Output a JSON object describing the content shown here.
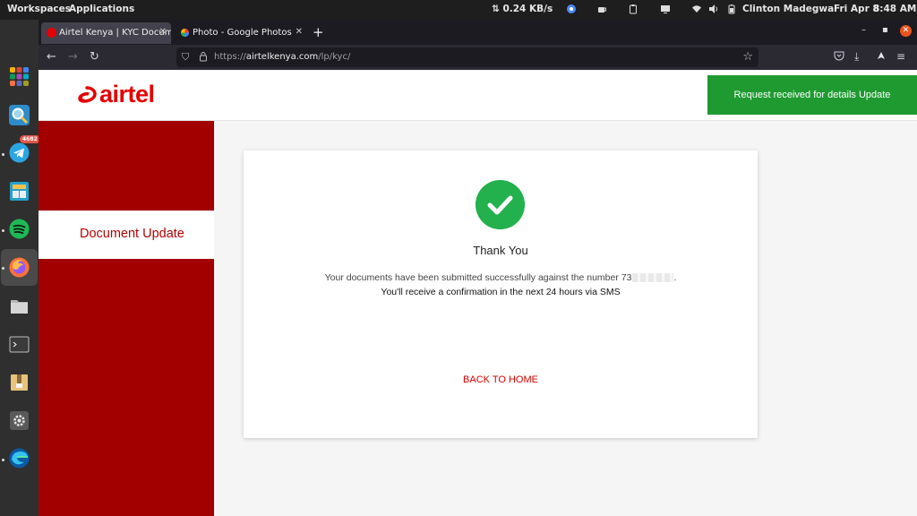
{
  "system_bar": {
    "workspaces": "Workspaces",
    "applications": "Applications",
    "net_speed": "⇅ 0.24 KB/s",
    "user": "Clinton Madegwa",
    "date": "Fri Apr 8",
    "time": "8:48 AM"
  },
  "dock": {
    "telegram_badge": "4682",
    "apps": [
      "apps-grid",
      "magnifier",
      "telegram",
      "window-manager",
      "spotify",
      "firefox",
      "files",
      "terminal",
      "archive",
      "settings",
      "edge"
    ]
  },
  "browser": {
    "tabs": [
      {
        "title": "Airtel Kenya | KYC Documen",
        "active": true
      },
      {
        "title": "Photo - Google Photos",
        "active": false
      }
    ],
    "url_prefix": "https://",
    "url_domain": "airtelkenya.com",
    "url_path": "/lp/kyc/"
  },
  "page": {
    "logo_text": "airtel",
    "notice": "Request received for details Update",
    "sidebar_active": "Document Update",
    "heading": "Thank You",
    "message_line1": "Your documents have been submitted successfully against the number 73",
    "message_line1_end": ".",
    "message_line2": "You'll receive a confirmation in the next 24 hours via SMS",
    "back_link": "BACK TO HOME"
  },
  "colors": {
    "airtel_red": "#e40000",
    "sidebar_red": "#a20000",
    "success_green": "#23b14d",
    "notice_green": "#1f9a31"
  }
}
